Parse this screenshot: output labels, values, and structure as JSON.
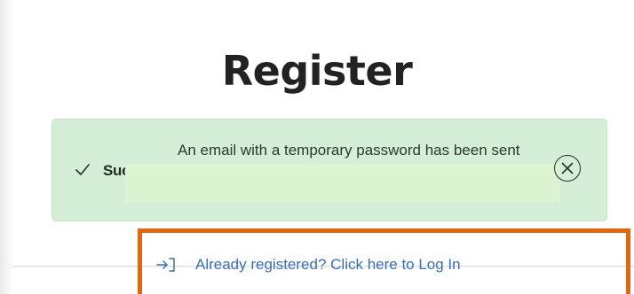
{
  "page": {
    "title": "Register"
  },
  "alert": {
    "heading": "Success",
    "message": "An email with a temporary password has been sent",
    "check_icon": "check-icon",
    "close_icon": "close-circle-icon",
    "colors": {
      "background": "#d5eed8",
      "border": "#c3e4c7"
    }
  },
  "login_link": {
    "label": "Already registered? Click here to Log In",
    "icon": "login-arrow-icon",
    "color": "#3b6fb0"
  },
  "highlight": {
    "color": "#e2650f"
  }
}
